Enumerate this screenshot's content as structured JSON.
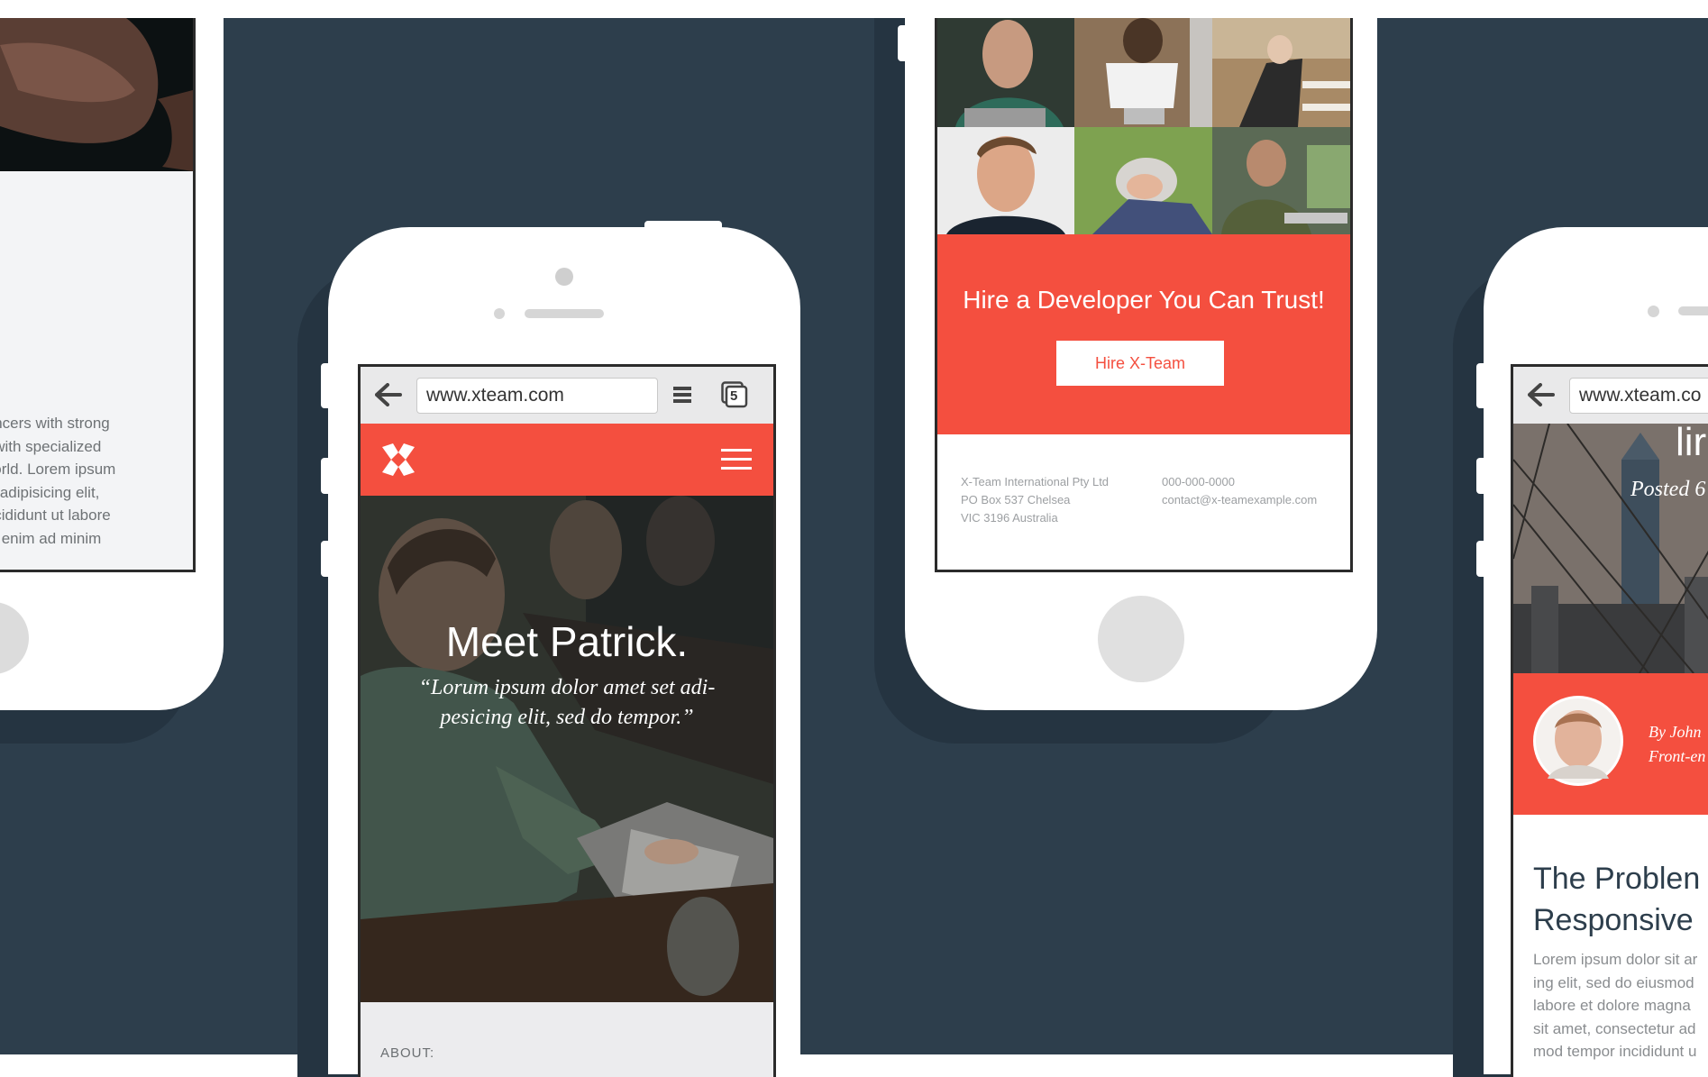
{
  "colors": {
    "background": "#2d3e4c",
    "accent": "#f44f3f",
    "phone": "#ffffff"
  },
  "phone1": {
    "body_lines": [
      "lancers with strong",
      "k with specialized",
      "world. Lorem ipsum",
      "ur adipisicing elit,",
      "incididunt ut labore",
      "Ut enim ad minim"
    ]
  },
  "phone2": {
    "url": "www.xteam.com",
    "tab_count": "5",
    "hero_title": "Meet Patrick.",
    "hero_quote_line1": "“Lorum ipsum dolor amet set adi-",
    "hero_quote_line2": "pesicing elit, sed do tempor.”",
    "about_label": "ABOUT:",
    "icons": {
      "back": "back-arrow-icon",
      "menu": "menu-icon",
      "tabs": "tabs-icon",
      "logo": "xteam-logo-icon",
      "hamburger": "hamburger-icon"
    }
  },
  "phone3": {
    "cta_title": "Hire a Developer You Can Trust!",
    "cta_button": "Hire X-Team",
    "address_lines": [
      "X-Team International Pty Ltd",
      "PO Box 537 Chelsea",
      "VIC 3196 Australia"
    ],
    "contact_lines": [
      "000-000-0000",
      "contact@x-teamexample.com"
    ]
  },
  "phone4": {
    "url": "www.xteam.co",
    "hero_fragment": "lir",
    "posted": "Posted 6",
    "by_line": "By John",
    "role_line": "Front-en",
    "heading_line1": "The Problen",
    "heading_line2": "Responsive",
    "body_lines": [
      "Lorem ipsum dolor sit ar",
      "ing elit, sed do eiusmod",
      "labore et dolore magna",
      "sit amet, consectetur ad",
      "mod tempor incididunt u"
    ]
  }
}
